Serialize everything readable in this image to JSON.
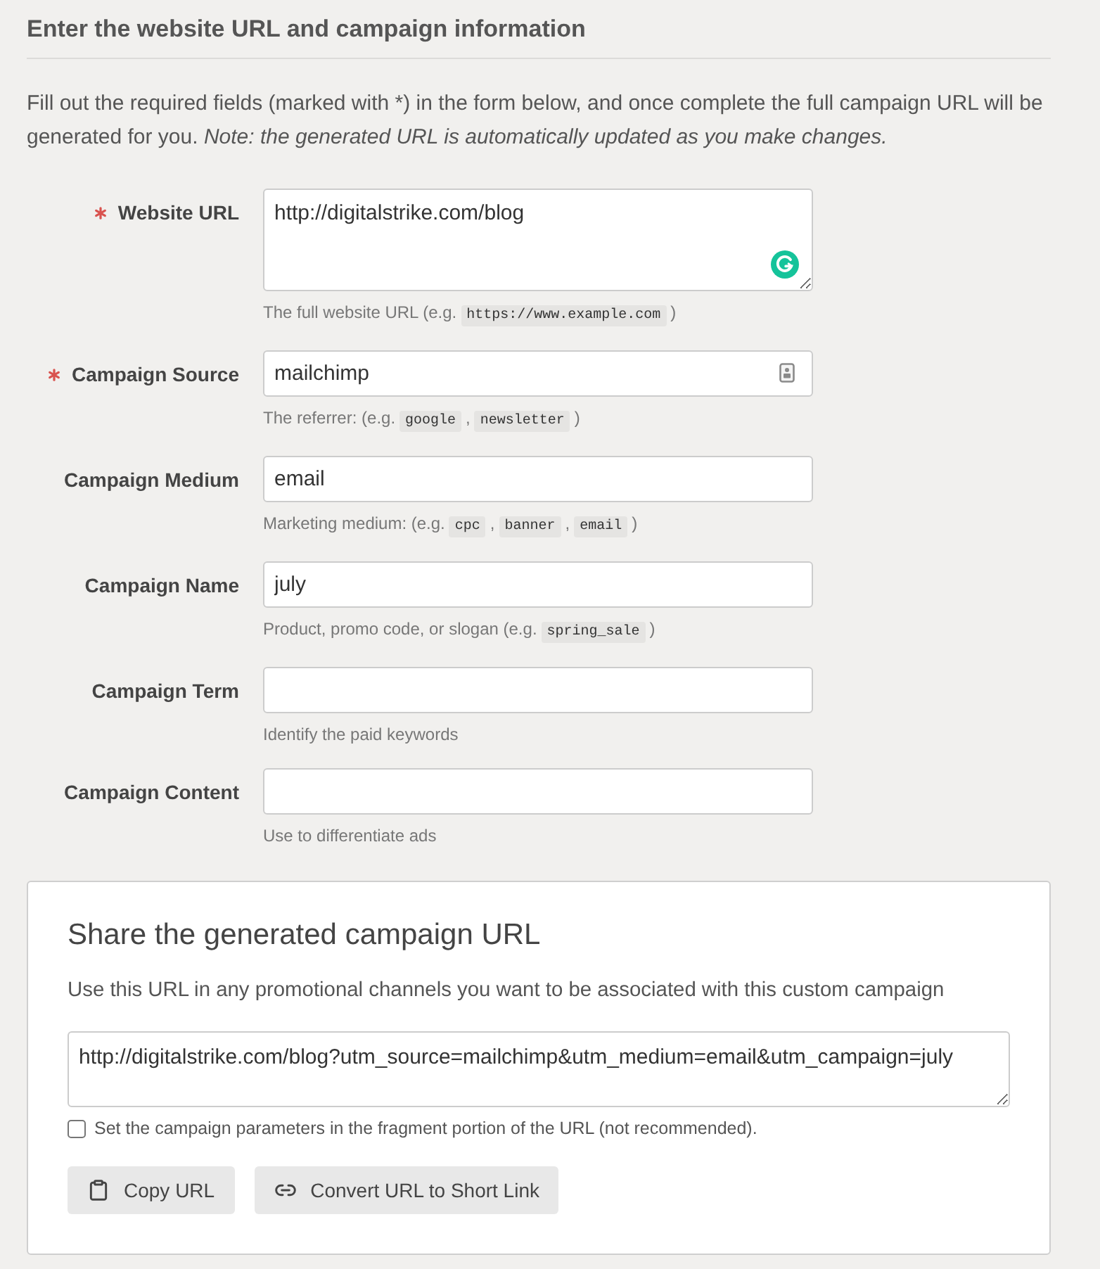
{
  "section": {
    "title": "Enter the website URL and campaign information",
    "intro": "Fill out the required fields (marked with *) in the form below, and once complete the full campaign URL will be generated for you.",
    "note": "Note: the generated URL is automatically updated as you make changes."
  },
  "fields": [
    {
      "label": "Website URL",
      "required": true,
      "kind": "textarea",
      "value": "http://digitalstrike.com/blog",
      "help": [
        {
          "kind": "text",
          "text": "The full website URL (e.g."
        },
        {
          "kind": "code",
          "text": "https://www.example.com"
        },
        {
          "kind": "text",
          "text": ")"
        }
      ]
    },
    {
      "label": "Campaign Source",
      "required": true,
      "kind": "input",
      "value": "mailchimp",
      "help": [
        {
          "kind": "text",
          "text": "The referrer: (e.g."
        },
        {
          "kind": "code",
          "text": "google"
        },
        {
          "kind": "text",
          "text": ","
        },
        {
          "kind": "code",
          "text": "newsletter"
        },
        {
          "kind": "text",
          "text": ")"
        }
      ]
    },
    {
      "label": "Campaign Medium",
      "required": false,
      "kind": "input",
      "value": "email",
      "help": [
        {
          "kind": "text",
          "text": "Marketing medium: (e.g."
        },
        {
          "kind": "code",
          "text": "cpc"
        },
        {
          "kind": "text",
          "text": ","
        },
        {
          "kind": "code",
          "text": "banner"
        },
        {
          "kind": "text",
          "text": ","
        },
        {
          "kind": "code",
          "text": "email"
        },
        {
          "kind": "text",
          "text": ")"
        }
      ]
    },
    {
      "label": "Campaign Name",
      "required": false,
      "kind": "input",
      "value": "july",
      "help": [
        {
          "kind": "text",
          "text": "Product, promo code, or slogan (e.g."
        },
        {
          "kind": "code",
          "text": "spring_sale"
        },
        {
          "kind": "text",
          "text": ")"
        }
      ]
    },
    {
      "label": "Campaign Term",
      "required": false,
      "kind": "input",
      "help": [
        {
          "kind": "text",
          "text": "Identify the paid keywords"
        }
      ]
    },
    {
      "label": "Campaign Content",
      "required": false,
      "kind": "input",
      "help": [
        {
          "kind": "text",
          "text": "Use to differentiate ads"
        }
      ]
    }
  ],
  "share": {
    "title": "Share the generated campaign URL",
    "description": "Use this URL in any promotional channels you want to be associated with this custom campaign",
    "generated_url": "http://digitalstrike.com/blog?utm_source=mailchimp&utm_medium=email&utm_campaign=july",
    "fragment_option": {
      "label": "Set the campaign parameters in the fragment portion of the URL (not recommended).",
      "checked": false
    },
    "buttons": [
      {
        "kind": "copy",
        "label": "Copy URL"
      },
      {
        "kind": "shorten",
        "label": "Convert URL to Short Link"
      }
    ]
  }
}
